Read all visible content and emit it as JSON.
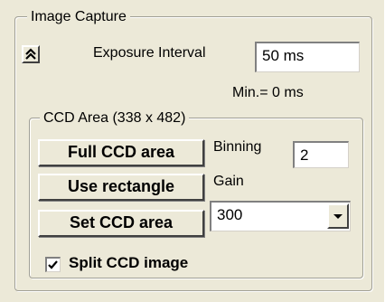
{
  "image_capture": {
    "legend": "Image Capture",
    "collapse_icon": "double-chevron-up-icon",
    "exposure_label": "Exposure Interval",
    "exposure_value": "50 ms",
    "min_label": "Min.= 0 ms"
  },
  "ccd_area": {
    "legend": "CCD Area (338 x 482)",
    "full_button": "Full CCD area",
    "rect_button": "Use rectangle",
    "set_button": "Set CCD area",
    "binning_label": "Binning",
    "binning_value": "2",
    "gain_label": "Gain",
    "gain_value": "300",
    "split_label": "Split CCD image",
    "split_checked": true
  }
}
